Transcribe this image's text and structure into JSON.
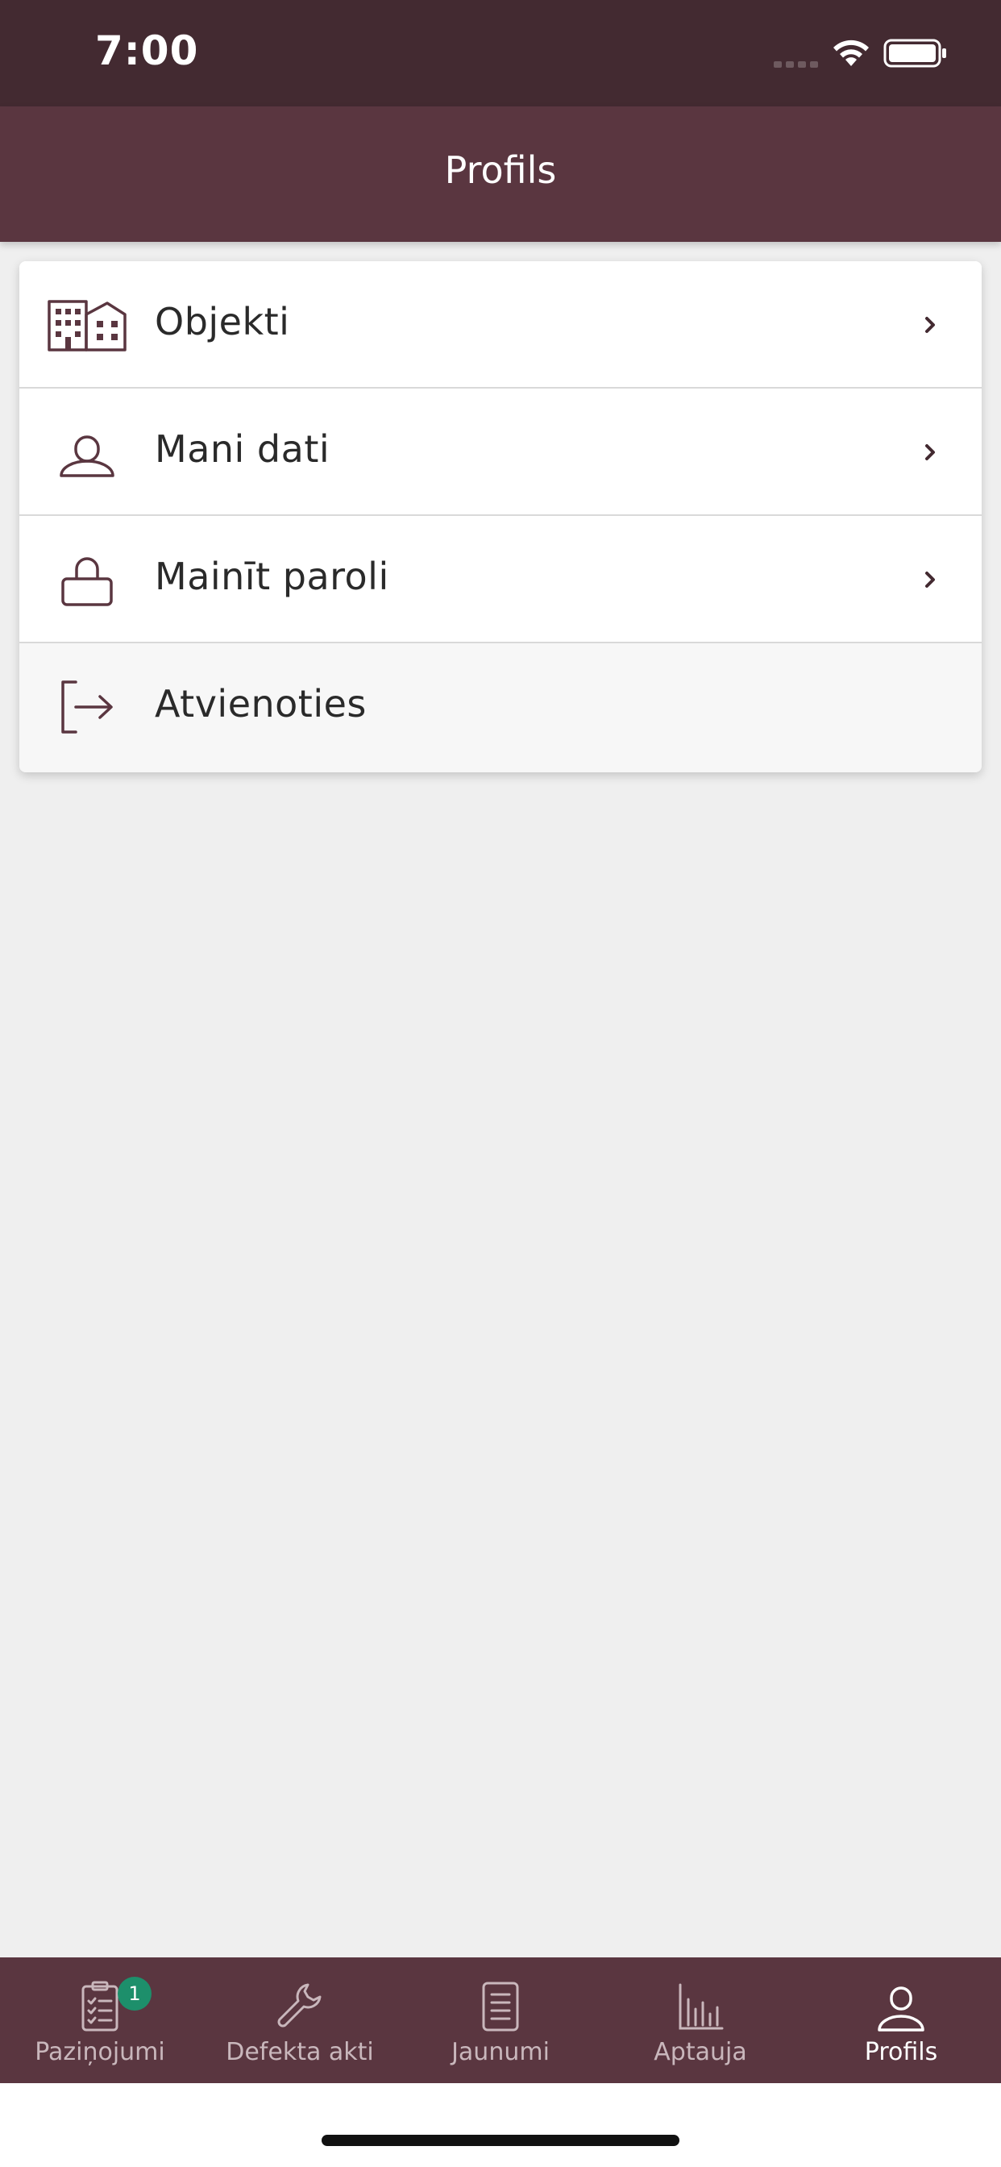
{
  "status_bar": {
    "time": "7:00"
  },
  "header": {
    "title": "Profils"
  },
  "menu": {
    "items": [
      {
        "label": "Objekti",
        "icon": "buildings-icon",
        "has_chevron": true
      },
      {
        "label": "Mani dati",
        "icon": "person-icon",
        "has_chevron": true
      },
      {
        "label": "Mainīt paroli",
        "icon": "lock-icon",
        "has_chevron": true
      },
      {
        "label": "Atvienoties",
        "icon": "logout-icon",
        "has_chevron": false
      }
    ]
  },
  "tab_bar": {
    "tabs": [
      {
        "label": "Paziņojumi",
        "icon": "clipboard-checklist-icon",
        "badge": "1",
        "active": false
      },
      {
        "label": "Defekta akti",
        "icon": "wrench-icon",
        "active": false
      },
      {
        "label": "Jaunumi",
        "icon": "document-icon",
        "active": false
      },
      {
        "label": "Aptauja",
        "icon": "bar-chart-icon",
        "active": false
      },
      {
        "label": "Profils",
        "icon": "person-icon",
        "active": true
      }
    ]
  },
  "colors": {
    "status_bar_bg": "#432a31",
    "header_bg": "#5a3640",
    "icon_color": "#5a3640",
    "badge_bg": "#1d8f6b",
    "page_bg": "#efefef"
  }
}
